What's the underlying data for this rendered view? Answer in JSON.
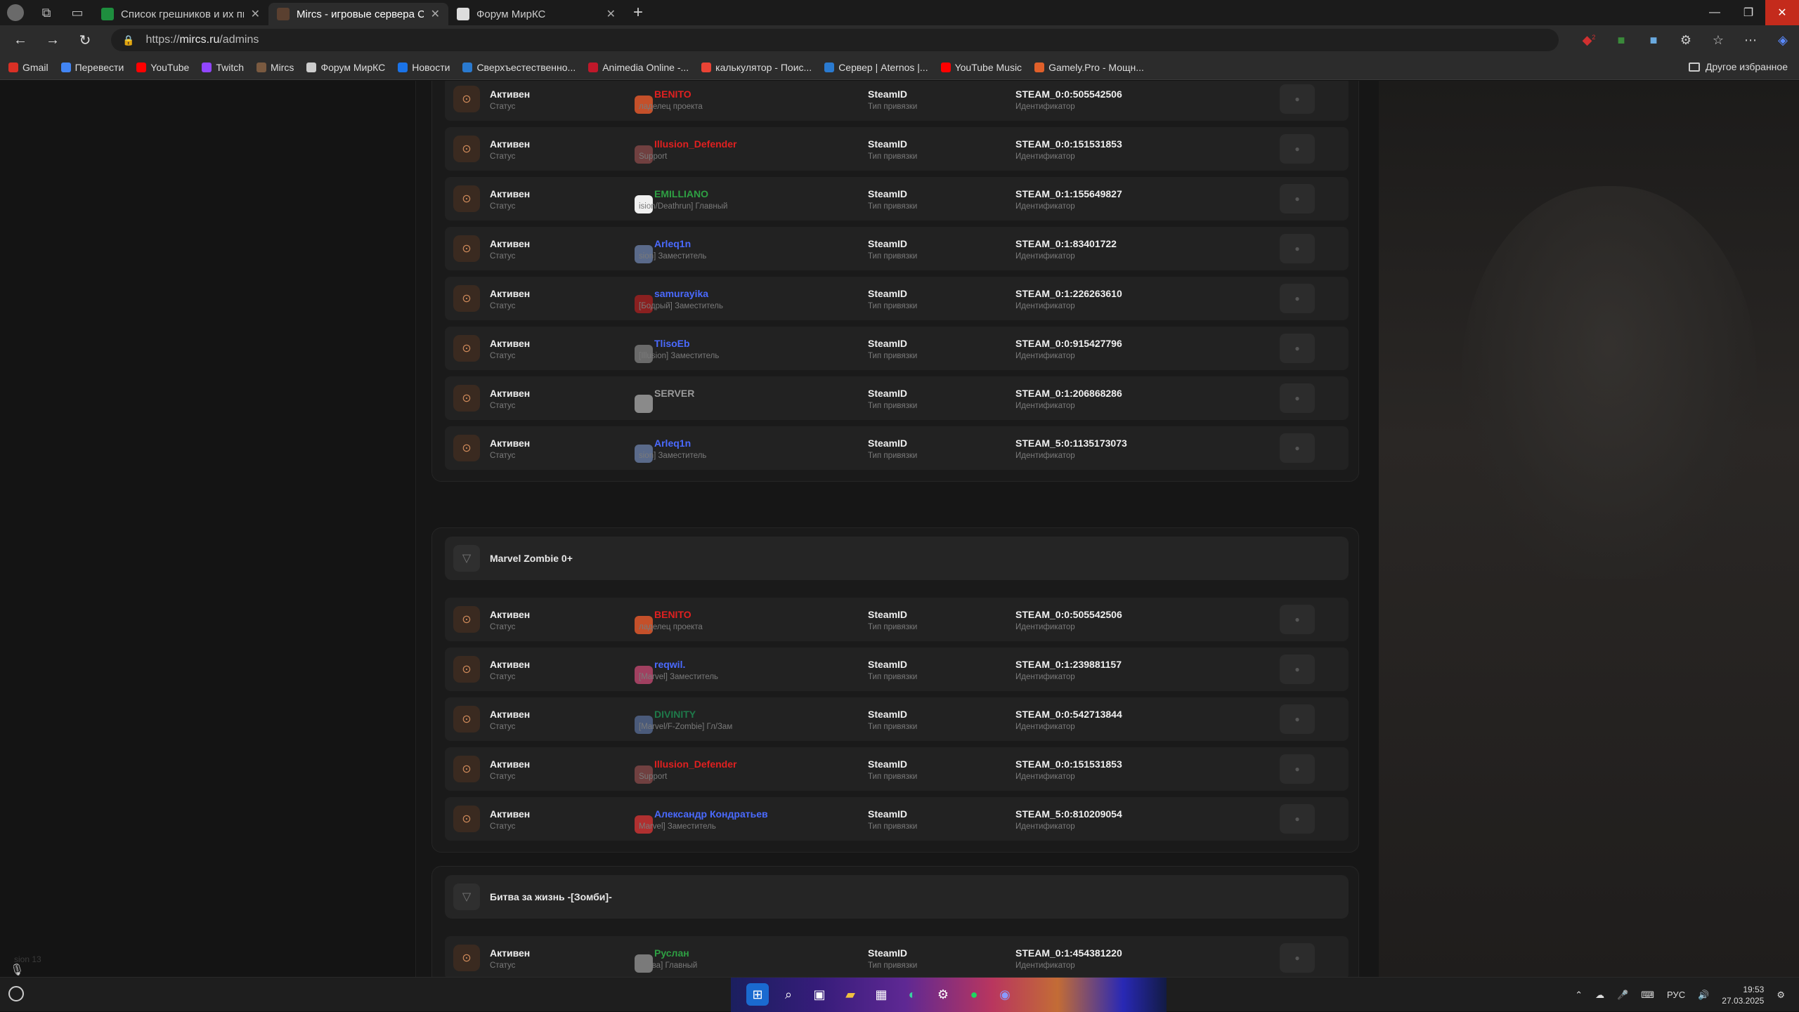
{
  "browser": {
    "tabs": [
      {
        "label": "Список грешников и их пиздюлей",
        "favicon_color": "#1e8e3e",
        "active": false
      },
      {
        "label": "Mircs - игровые сервера Counter",
        "favicon_color": "#5a4030",
        "active": true
      },
      {
        "label": "Форум МирКС",
        "favicon_color": "#ddd",
        "active": false
      }
    ],
    "url_prefix": "https://",
    "url_host": "mircs.ru",
    "url_path": "/admins",
    "bookmarks": [
      {
        "label": "Gmail",
        "color": "#d93025"
      },
      {
        "label": "Перевести",
        "color": "#4285f4"
      },
      {
        "label": "YouTube",
        "color": "#ff0000"
      },
      {
        "label": "Twitch",
        "color": "#9146ff"
      },
      {
        "label": "Mircs",
        "color": "#7a5a40"
      },
      {
        "label": "Форум МирКС",
        "color": "#cccccc"
      },
      {
        "label": "Новости",
        "color": "#1a73e8"
      },
      {
        "label": "Сверхъестественно...",
        "color": "#2a7ad0"
      },
      {
        "label": "Animedia Online -...",
        "color": "#c0182a"
      },
      {
        "label": "калькулятор - Поис...",
        "color": "#ea4335"
      },
      {
        "label": "Сервер | Aternos |...",
        "color": "#2a7ad0"
      },
      {
        "label": "YouTube Music",
        "color": "#ff0000"
      },
      {
        "label": "Gamely.Pro - Мощн...",
        "color": "#e0602a"
      }
    ],
    "other_bookmarks": "Другое избранное",
    "extension_badge": "2"
  },
  "labels": {
    "status_sub": "Статус",
    "bind_type_sub": "Тип привязки",
    "identifier_sub": "Идентификатор"
  },
  "sections": [
    {
      "title": "",
      "rows": [
        {
          "status": "Активен",
          "name": "BENITO",
          "name_color": "#e02020",
          "group": "ладелец проекта",
          "avatar_color": "#c4502a",
          "bind": "SteamID",
          "id": "STEAM_0:0:505542506"
        },
        {
          "status": "Активен",
          "name": "Illusion_Defender",
          "name_color": "#e02020",
          "group": "Support",
          "avatar_color": "#704040",
          "bind": "SteamID",
          "id": "STEAM_0:0:151531853"
        },
        {
          "status": "Активен",
          "name": "EMILLIANO",
          "name_color": "#2ea043",
          "group": "ision/Deathrun] Главный",
          "avatar_color": "#f0f0f0",
          "bind": "SteamID",
          "id": "STEAM_0:1:155649827"
        },
        {
          "status": "Активен",
          "name": "Arleq1n",
          "name_color": "#4a6aff",
          "group": "sion] Заместитель",
          "avatar_color": "#5a6a8a",
          "bind": "SteamID",
          "id": "STEAM_0:1:83401722"
        },
        {
          "status": "Активен",
          "name": "samurayika",
          "name_color": "#4a6aff",
          "group": "[Бодрый] Заместитель",
          "avatar_color": "#8a2020",
          "bind": "SteamID",
          "id": "STEAM_0:1:226263610"
        },
        {
          "status": "Активен",
          "name": "TlisoEb",
          "name_color": "#4a6aff",
          "group": "[Illusion] Заместитель",
          "avatar_color": "#6a6a6a",
          "bind": "SteamID",
          "id": "STEAM_0:0:915427796"
        },
        {
          "status": "Активен",
          "name": "SERVER",
          "name_color": "#9a9a9a",
          "group": "",
          "avatar_color": "#8a8a8a",
          "bind": "SteamID",
          "id": "STEAM_0:1:206868286"
        },
        {
          "status": "Активен",
          "name": "Arleq1n",
          "name_color": "#4a6aff",
          "group": "sion] Заместитель",
          "avatar_color": "#5a6a8a",
          "bind": "SteamID",
          "id": "STEAM_5:0:1135173073"
        }
      ]
    },
    {
      "title": "Marvel Zombie 0+",
      "rows": [
        {
          "status": "Активен",
          "name": "BENITO",
          "name_color": "#e02020",
          "group": "ладелец проекта",
          "avatar_color": "#c4502a",
          "bind": "SteamID",
          "id": "STEAM_0:0:505542506"
        },
        {
          "status": "Активен",
          "name": "reqwil.",
          "name_color": "#4a6aff",
          "group": "[Marvel] Заместитель",
          "avatar_color": "#a04060",
          "bind": "SteamID",
          "id": "STEAM_0:1:239881157"
        },
        {
          "status": "Активен",
          "name": "DIVINITY",
          "name_color": "#1e7a4a",
          "group": "[Marvel/F-Zombie] Гл/Зам",
          "avatar_color": "#4a5a7a",
          "bind": "SteamID",
          "id": "STEAM_0:0:542713844"
        },
        {
          "status": "Активен",
          "name": "Illusion_Defender",
          "name_color": "#e02020",
          "group": "Support",
          "avatar_color": "#704040",
          "bind": "SteamID",
          "id": "STEAM_0:0:151531853"
        },
        {
          "status": "Активен",
          "name": "Александр Кондратьев",
          "name_color": "#4a6aff",
          "group": "Marvel] Заместитель",
          "avatar_color": "#b03030",
          "bind": "SteamID",
          "id": "STEAM_5:0:810209054"
        }
      ]
    },
    {
      "title": "Битва за жизнь -[Зомби]-",
      "rows": [
        {
          "status": "Активен",
          "name": "Руслан",
          "name_color": "#2ea043",
          "group": "Глава] Главный",
          "avatar_color": "#7a7a7a",
          "bind": "SteamID",
          "id": "STEAM_0:1:454381220"
        }
      ]
    }
  ],
  "version_text": "sion 13",
  "taskbar": {
    "language": "РУС",
    "time": "19:53",
    "date": "27.03.2025"
  }
}
